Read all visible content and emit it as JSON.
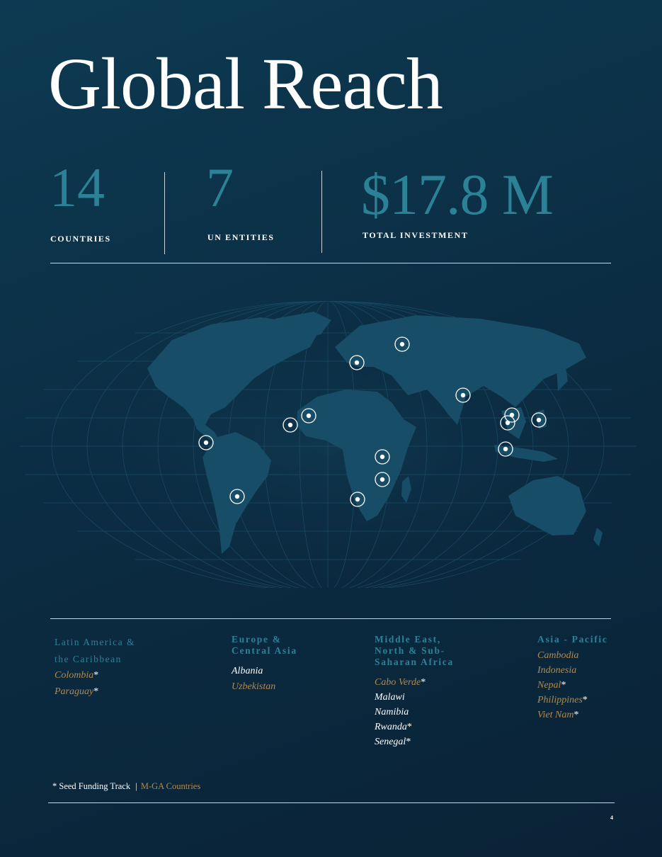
{
  "title": "Global Reach",
  "stats": [
    {
      "value": "14",
      "label": "COUNTRIES"
    },
    {
      "value": "7",
      "label": "UN ENTITIES"
    },
    {
      "value": "$17.8 M",
      "label": "TOTAL INVESTMENT"
    }
  ],
  "regions": [
    {
      "heading": [
        "Latin America &",
        "the Caribbean"
      ],
      "countries": [
        {
          "name": "Colombia",
          "star": "*",
          "mga": true
        },
        {
          "name": "Paraguay",
          "star": "*",
          "mga": true
        }
      ]
    },
    {
      "heading": [
        "Europe &",
        "Central Asia"
      ],
      "countries": [
        {
          "name": "Albania",
          "star": "",
          "mga": false
        },
        {
          "name": "Uzbekistan",
          "star": "",
          "mga": true
        }
      ]
    },
    {
      "heading": [
        "Middle East,",
        "North & Sub-",
        "Saharan Africa"
      ],
      "countries": [
        {
          "name": "Cabo Verde",
          "star": "*",
          "mga": true
        },
        {
          "name": "Malawi",
          "star": "",
          "mga": false
        },
        {
          "name": "Namibia",
          "star": "",
          "mga": false
        },
        {
          "name": "Rwanda",
          "star": "*",
          "mga": false
        },
        {
          "name": "Senegal",
          "star": "*",
          "mga": false
        }
      ]
    },
    {
      "heading": [
        "Asia - Pacific"
      ],
      "countries": [
        {
          "name": "Cambodia",
          "star": "",
          "mga": true
        },
        {
          "name": "Indonesia",
          "star": "",
          "mga": true
        },
        {
          "name": "Nepal",
          "star": "*",
          "mga": true
        },
        {
          "name": "Philippines",
          "star": "*",
          "mga": true
        },
        {
          "name": "Viet Nam",
          "star": "*",
          "mga": true
        }
      ]
    }
  ],
  "footnote": {
    "text": "* Seed Funding Track",
    "separator": "|",
    "mga_label": "M-GA Countries"
  },
  "page_number": "4",
  "colors": {
    "accent_teal": "#2b8296",
    "mga_gold": "#b08a4e",
    "land": "#174d66",
    "background": "#0b2c42"
  }
}
